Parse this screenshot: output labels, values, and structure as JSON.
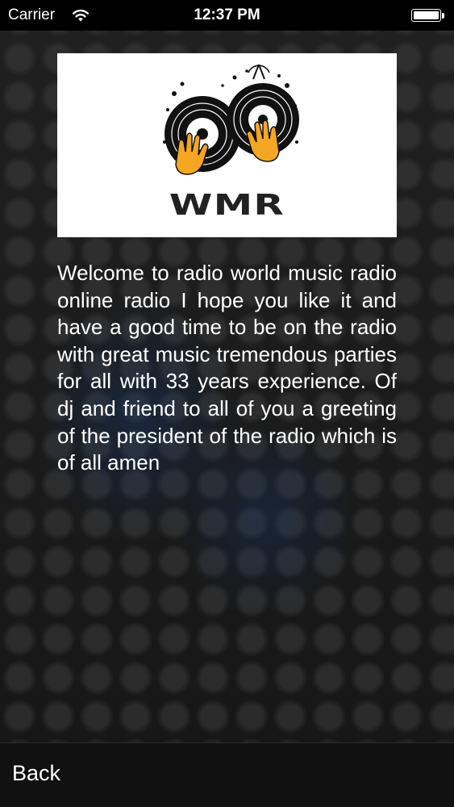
{
  "status_bar": {
    "carrier": "Carrier",
    "time": "12:37 PM",
    "wifi_icon": "wifi-icon",
    "battery_icon": "battery-icon",
    "battery_level": 1.0
  },
  "logo": {
    "icon": "turntable-hands-logo",
    "text": "WMR",
    "accent_color": "#f5a623"
  },
  "content": {
    "welcome_text": "Welcome to radio world music radio online radio I hope you like it and have a good time to be on the radio with great music tremendous parties for all with 33 years experience. Of dj and friend to all of you a greeting of the president of the radio which is of all amen"
  },
  "navigation": {
    "back_label": "Back"
  }
}
